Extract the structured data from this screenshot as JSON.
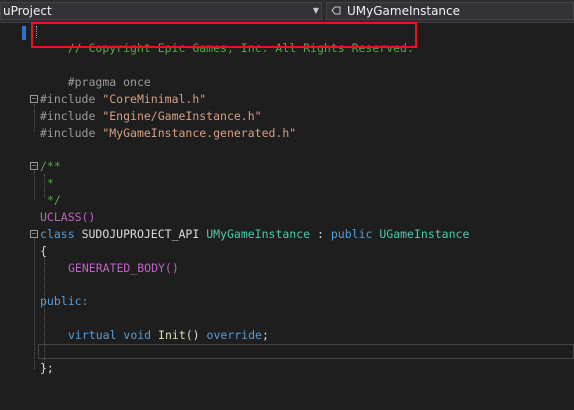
{
  "toolbar": {
    "project_dropdown": "uProject",
    "member_dropdown": "UMyGameInstance"
  },
  "code": {
    "copyright": "// Copyright Epic Games, Inc. All Rights Reserved.",
    "pragma": "#pragma once",
    "include_kw": "#include",
    "include1": "\"CoreMinimal.h\"",
    "include2": "\"Engine/GameInstance.h\"",
    "include3": "\"MyGameInstance.generated.h\"",
    "doc_open": "/**",
    "doc_star": " *",
    "doc_close": " */",
    "uclass": "UCLASS()",
    "class_kw": "class",
    "api_macro": "SUDOJUPROJECT_API",
    "class_name": "UMyGameInstance",
    "colon": ":",
    "public_kw": "public",
    "base_class": "UGameInstance",
    "open_brace": "{",
    "generated_body": "GENERATED_BODY()",
    "public_label": "public:",
    "virtual_kw": "virtual",
    "void_kw": "void",
    "init_fn": "Init",
    "parens": "()",
    "override_kw": "override",
    "semicolon": ";",
    "close_brace": "};"
  },
  "colors": {
    "comment": "#57a64a",
    "keyword": "#569cd6",
    "string": "#d69d85",
    "type": "#4ec9b0",
    "macro": "#bd63c5",
    "function": "#dcdcaa",
    "highlight_box": "#e8141b"
  }
}
